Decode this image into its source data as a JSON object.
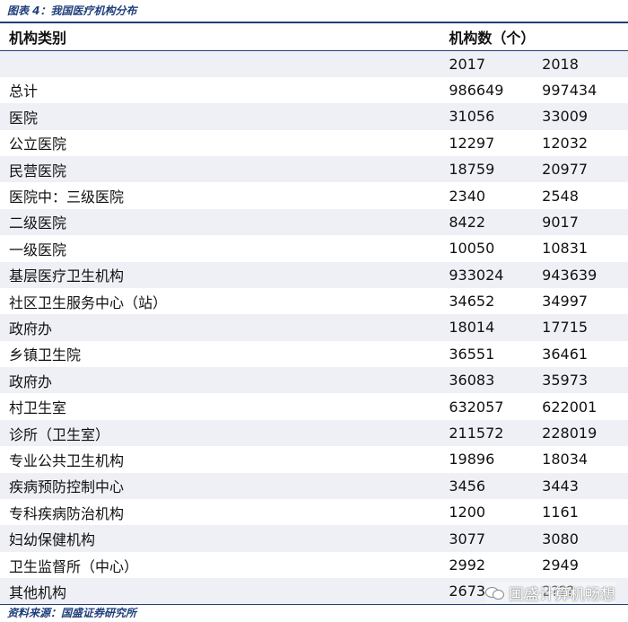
{
  "caption": "图表 4：我国医疗机构分布",
  "source": "资料来源：国盛证券研究所",
  "watermark": "国盛计算机畅想",
  "table": {
    "header_col1": "机构类别",
    "header_col2": "机构数（个）",
    "years": [
      "2017",
      "2018"
    ],
    "rows": [
      {
        "label": "总计",
        "v2017": "986649",
        "v2018": "997434"
      },
      {
        "label": "医院",
        "v2017": "31056",
        "v2018": "33009"
      },
      {
        "label": "公立医院",
        "v2017": "12297",
        "v2018": "12032"
      },
      {
        "label": "民营医院",
        "v2017": "18759",
        "v2018": "20977"
      },
      {
        "label": "医院中：三级医院",
        "v2017": "2340",
        "v2018": "2548"
      },
      {
        "label": "二级医院",
        "v2017": "8422",
        "v2018": "9017"
      },
      {
        "label": "一级医院",
        "v2017": "10050",
        "v2018": "10831"
      },
      {
        "label": "基层医疗卫生机构",
        "v2017": "933024",
        "v2018": "943639"
      },
      {
        "label": "社区卫生服务中心（站）",
        "v2017": "34652",
        "v2018": "34997"
      },
      {
        "label": "政府办",
        "v2017": "18014",
        "v2018": "17715"
      },
      {
        "label": "乡镇卫生院",
        "v2017": "36551",
        "v2018": "36461"
      },
      {
        "label": "政府办",
        "v2017": "36083",
        "v2018": "35973"
      },
      {
        "label": "村卫生室",
        "v2017": "632057",
        "v2018": "622001"
      },
      {
        "label": "诊所（卫生室）",
        "v2017": "211572",
        "v2018": "228019"
      },
      {
        "label": "专业公共卫生机构",
        "v2017": "19896",
        "v2018": "18034"
      },
      {
        "label": "疾病预防控制中心",
        "v2017": "3456",
        "v2018": "3443"
      },
      {
        "label": "专科疾病防治机构",
        "v2017": "1200",
        "v2018": "1161"
      },
      {
        "label": "妇幼保健机构",
        "v2017": "3077",
        "v2018": "3080"
      },
      {
        "label": "卫生监督所（中心）",
        "v2017": "2992",
        "v2018": "2949"
      },
      {
        "label": "其他机构",
        "v2017": "2673",
        "v2018": "2???"
      }
    ]
  }
}
